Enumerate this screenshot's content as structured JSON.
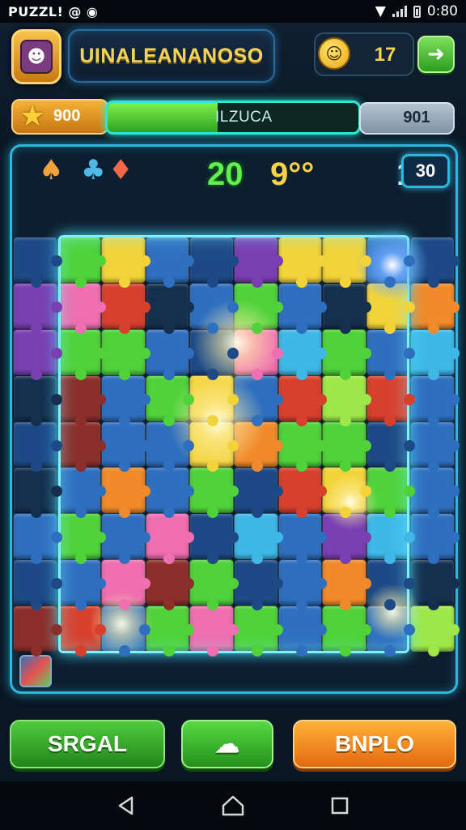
{
  "status": {
    "app_label": "PUZZL!",
    "time": "0:80"
  },
  "header": {
    "player_name": "UINALEANANOSO",
    "coin_count": "17",
    "star_value": "900",
    "progress_label": "ILZUCA",
    "progress_fraction": 0.44,
    "target_value": "901"
  },
  "scoreboard": {
    "score_a": "20",
    "score_b": "9°°",
    "score_c": "1",
    "moves_left": "30"
  },
  "board": {
    "columns": 10,
    "rows": 9,
    "palette": {
      "b": "#2f6fbf",
      "d": "#1d4a86",
      "n": "#15304f",
      "g": "#4fd23a",
      "y": "#f2d43a",
      "p": "#ef6fb0",
      "r": "#d8402e",
      "m": "#8c2f2a",
      "v": "#7a3fb3",
      "o": "#f08a2a",
      "l": "#9fe84a",
      "c": "#3fb8e8"
    },
    "cells": [
      "dgybdvyybd",
      "vprnbgbnyo",
      "vggbdpcgbc",
      "nmbgybrlrb",
      "dmbbyoggdb",
      "nbobgdrygb",
      "bgbpdcbvcb",
      "dbpmgdbodn",
      "mrbgpgbgbl"
    ]
  },
  "buttons": {
    "left_label": "SRGAL",
    "right_label": "BNPLO"
  },
  "icons": {
    "avatar": "monster-avatar-icon",
    "coin": "smiley-coin-icon",
    "next": "arrow-right-icon",
    "star": "star-icon",
    "middle_button": "hint-card-icon"
  },
  "colors": {
    "accent_cyan": "#2fb6e0",
    "accent_green": "#4fca3c",
    "accent_orange": "#f08a2a",
    "gold_text": "#f4d35a"
  }
}
